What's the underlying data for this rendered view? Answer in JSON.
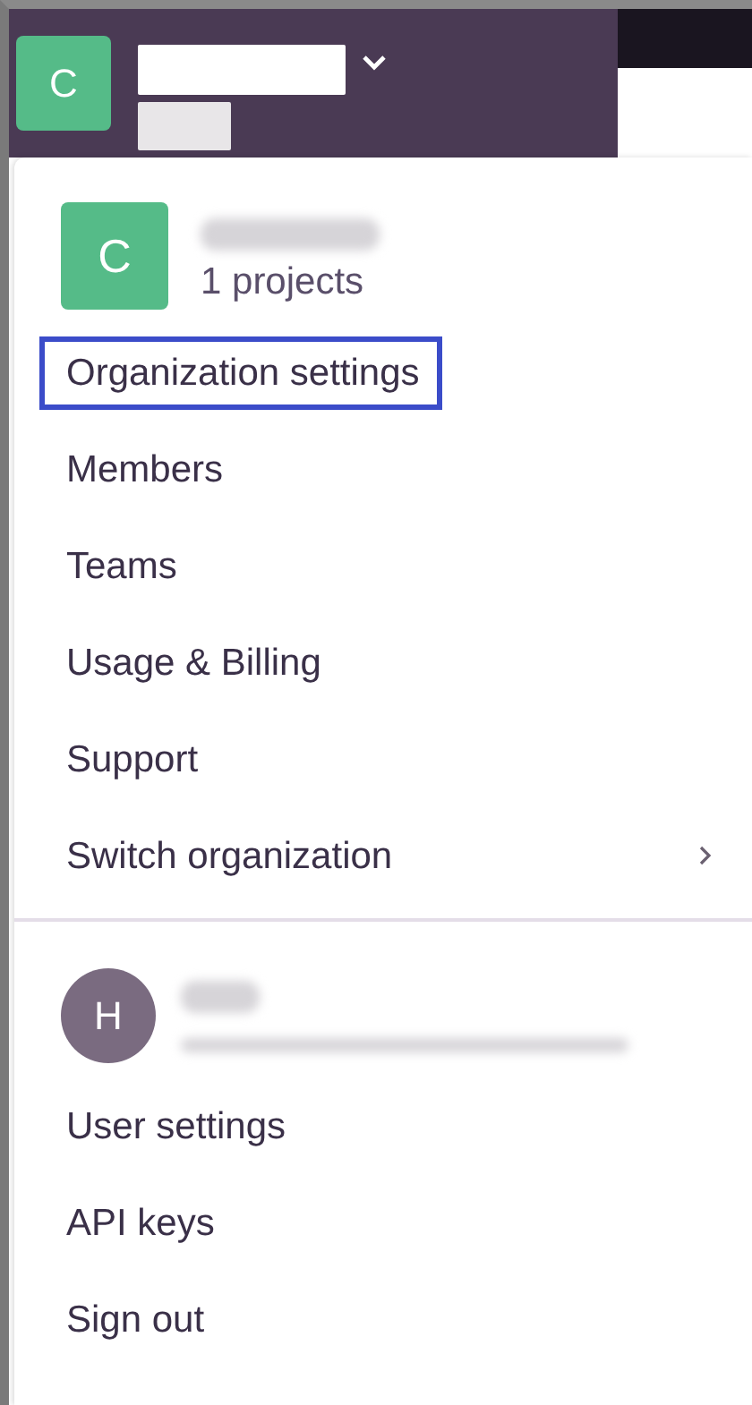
{
  "header": {
    "org_avatar": "C"
  },
  "menu": {
    "org": {
      "avatar": "C",
      "projects": "1 projects"
    },
    "org_items": [
      {
        "label": "Organization settings",
        "focused": true,
        "has_submenu": false
      },
      {
        "label": "Members",
        "focused": false,
        "has_submenu": false
      },
      {
        "label": "Teams",
        "focused": false,
        "has_submenu": false
      },
      {
        "label": "Usage & Billing",
        "focused": false,
        "has_submenu": false
      },
      {
        "label": "Support",
        "focused": false,
        "has_submenu": false
      },
      {
        "label": "Switch organization",
        "focused": false,
        "has_submenu": true
      }
    ],
    "user": {
      "avatar": "H"
    },
    "user_items": [
      {
        "label": "User settings",
        "focused": false,
        "has_submenu": false
      },
      {
        "label": "API keys",
        "focused": false,
        "has_submenu": false
      },
      {
        "label": "Sign out",
        "focused": false,
        "has_submenu": false
      }
    ]
  }
}
